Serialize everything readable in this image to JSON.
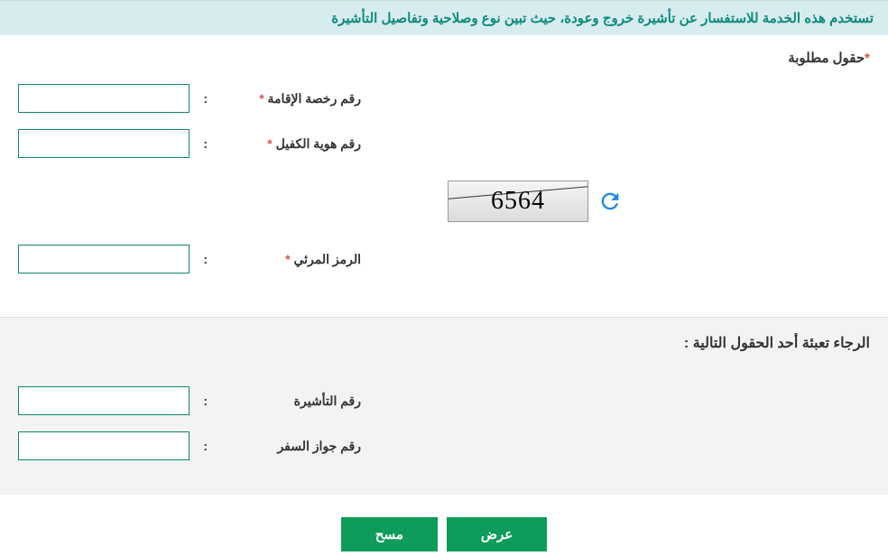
{
  "banner": {
    "text": "تستخدم هذه الخدمة للاستفسار عن تأشيرة خروج وعودة، حيث تبين نوع وصلاحية وتفاصيل التأشيرة"
  },
  "requiredNote": {
    "asterisk": "*",
    "text": "حقول مطلوبة"
  },
  "fields": {
    "iqama": {
      "label": "رقم رخصة الإقامة",
      "asterisk": "*",
      "value": ""
    },
    "sponsor": {
      "label": "رقم هوية الكفيل",
      "asterisk": "*",
      "value": ""
    },
    "captcha": {
      "label": "الرمز المرئي",
      "asterisk": "*",
      "value": "",
      "imageText": "6564"
    },
    "visa": {
      "label": "رقم التأشيرة",
      "value": ""
    },
    "passport": {
      "label": "رقم جواز السفر",
      "value": ""
    }
  },
  "sectionHeader": {
    "text": "الرجاء تعبئة أحد الحقول التالية :"
  },
  "buttons": {
    "view": "عرض",
    "clear": "مسح"
  },
  "colon": ":"
}
